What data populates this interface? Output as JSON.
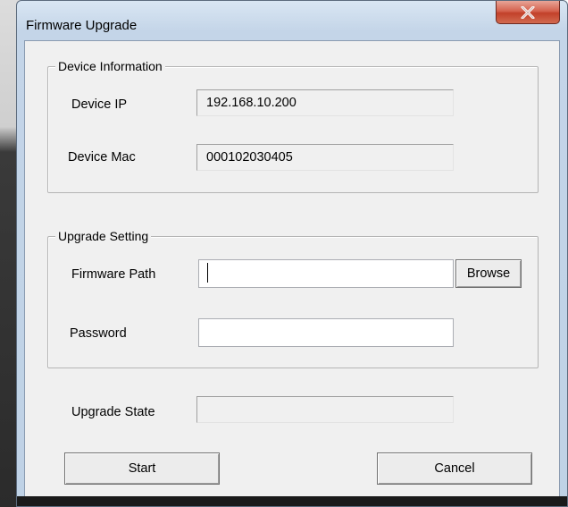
{
  "window": {
    "title": "Firmware Upgrade",
    "close_glyph": "X"
  },
  "device_info": {
    "legend": "Device Information",
    "ip_label": "Device IP",
    "ip_value": "192.168.10.200",
    "mac_label": "Device Mac",
    "mac_value": "000102030405"
  },
  "upgrade_setting": {
    "legend": "Upgrade Setting",
    "path_label": "Firmware Path",
    "path_value": "",
    "browse_label": "Browse",
    "password_label": "Password",
    "password_value": ""
  },
  "state": {
    "label": "Upgrade State",
    "value": ""
  },
  "actions": {
    "start_label": "Start",
    "cancel_label": "Cancel"
  }
}
